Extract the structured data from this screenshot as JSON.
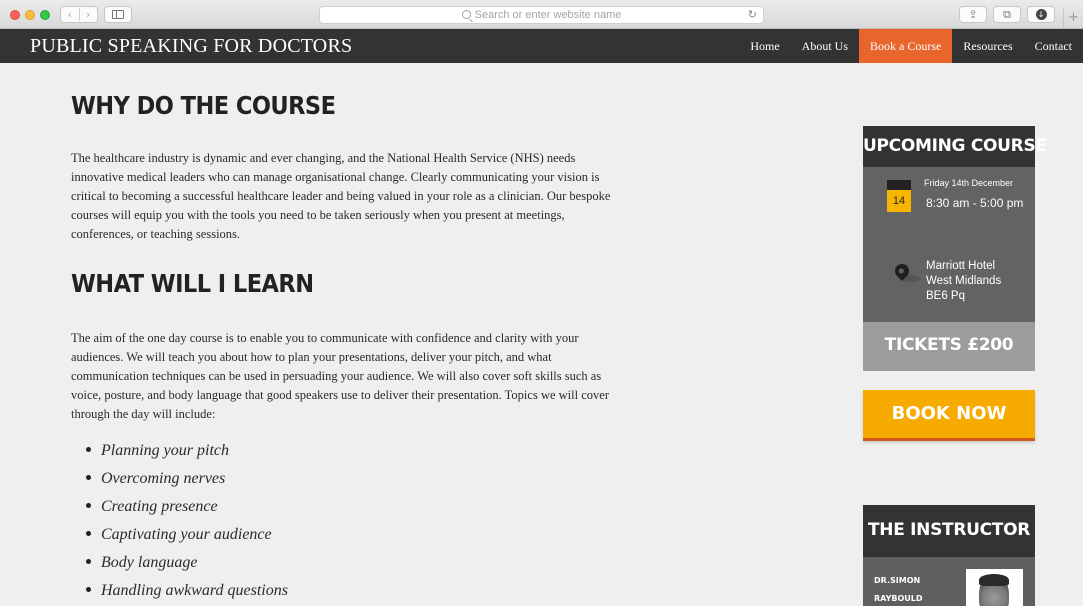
{
  "browser": {
    "url_placeholder": "Search or enter website name",
    "nav_back_glyph": "‹",
    "nav_forward_glyph": "›",
    "reload_glyph": "↻",
    "share_glyph": "⇪",
    "tabs_glyph": "⧉",
    "download_glyph": "↓",
    "newtab_glyph": "+",
    "traffic_light_colors": [
      "#fc605c",
      "#fdbc40",
      "#34c84a"
    ]
  },
  "site": {
    "logo": "PUBLIC SPEAKING FOR DOCTORS",
    "nav": [
      {
        "label": "Home"
      },
      {
        "label": "About Us"
      },
      {
        "label": "Book a Course"
      },
      {
        "label": "Resources"
      },
      {
        "label": "Contact"
      }
    ],
    "header_color": "#333333",
    "accent_color": "#e8652b"
  },
  "main": {
    "why_heading": "WHY DO THE COURSE",
    "why_text": "The healthcare industry is dynamic and ever changing, and the National Health Service (NHS) needs innovative medical leaders who can manage organisational change. Clearly communicating your vision is critical to becoming a successful healthcare leader and being valued in your role as a clinician. Our bespoke courses will equip you with the tools you need to be taken seriously when you present at meetings, conferences, or teaching sessions.",
    "learn_heading": "WHAT WILL I LEARN",
    "learn_text": "The aim of the one day course is to enable you to communicate with confidence and clarity with your audiences. We will teach you about how to plan your presentations, deliver your pitch, and what communication techniques can be used in persuading your audience. We will also cover soft skills such as voice, posture, and body language that good speakers use to deliver their presentation. Topics we will cover through the day will include:",
    "topics": [
      "Planning your pitch",
      "Overcoming nerves",
      "Creating presence",
      "Captivating your audience",
      "Body language",
      "Handling awkward questions"
    ]
  },
  "sidebar": {
    "upcoming_title": "UPCOMING COURSE",
    "calendar_day": "14",
    "date": "Friday 14th December",
    "time": "8:30 am - 5:00 pm",
    "address_lines": [
      "Marriott Hotel",
      "West Midlands",
      "BE6 Pq"
    ],
    "tickets": "TICKETS £200",
    "book_now": "BOOK NOW",
    "book_color": "#f7ab00",
    "instructor_title": "THE INSTRUCTOR",
    "instructor_name_lines": [
      "DR.SIMON",
      "RAYBOULD"
    ]
  }
}
